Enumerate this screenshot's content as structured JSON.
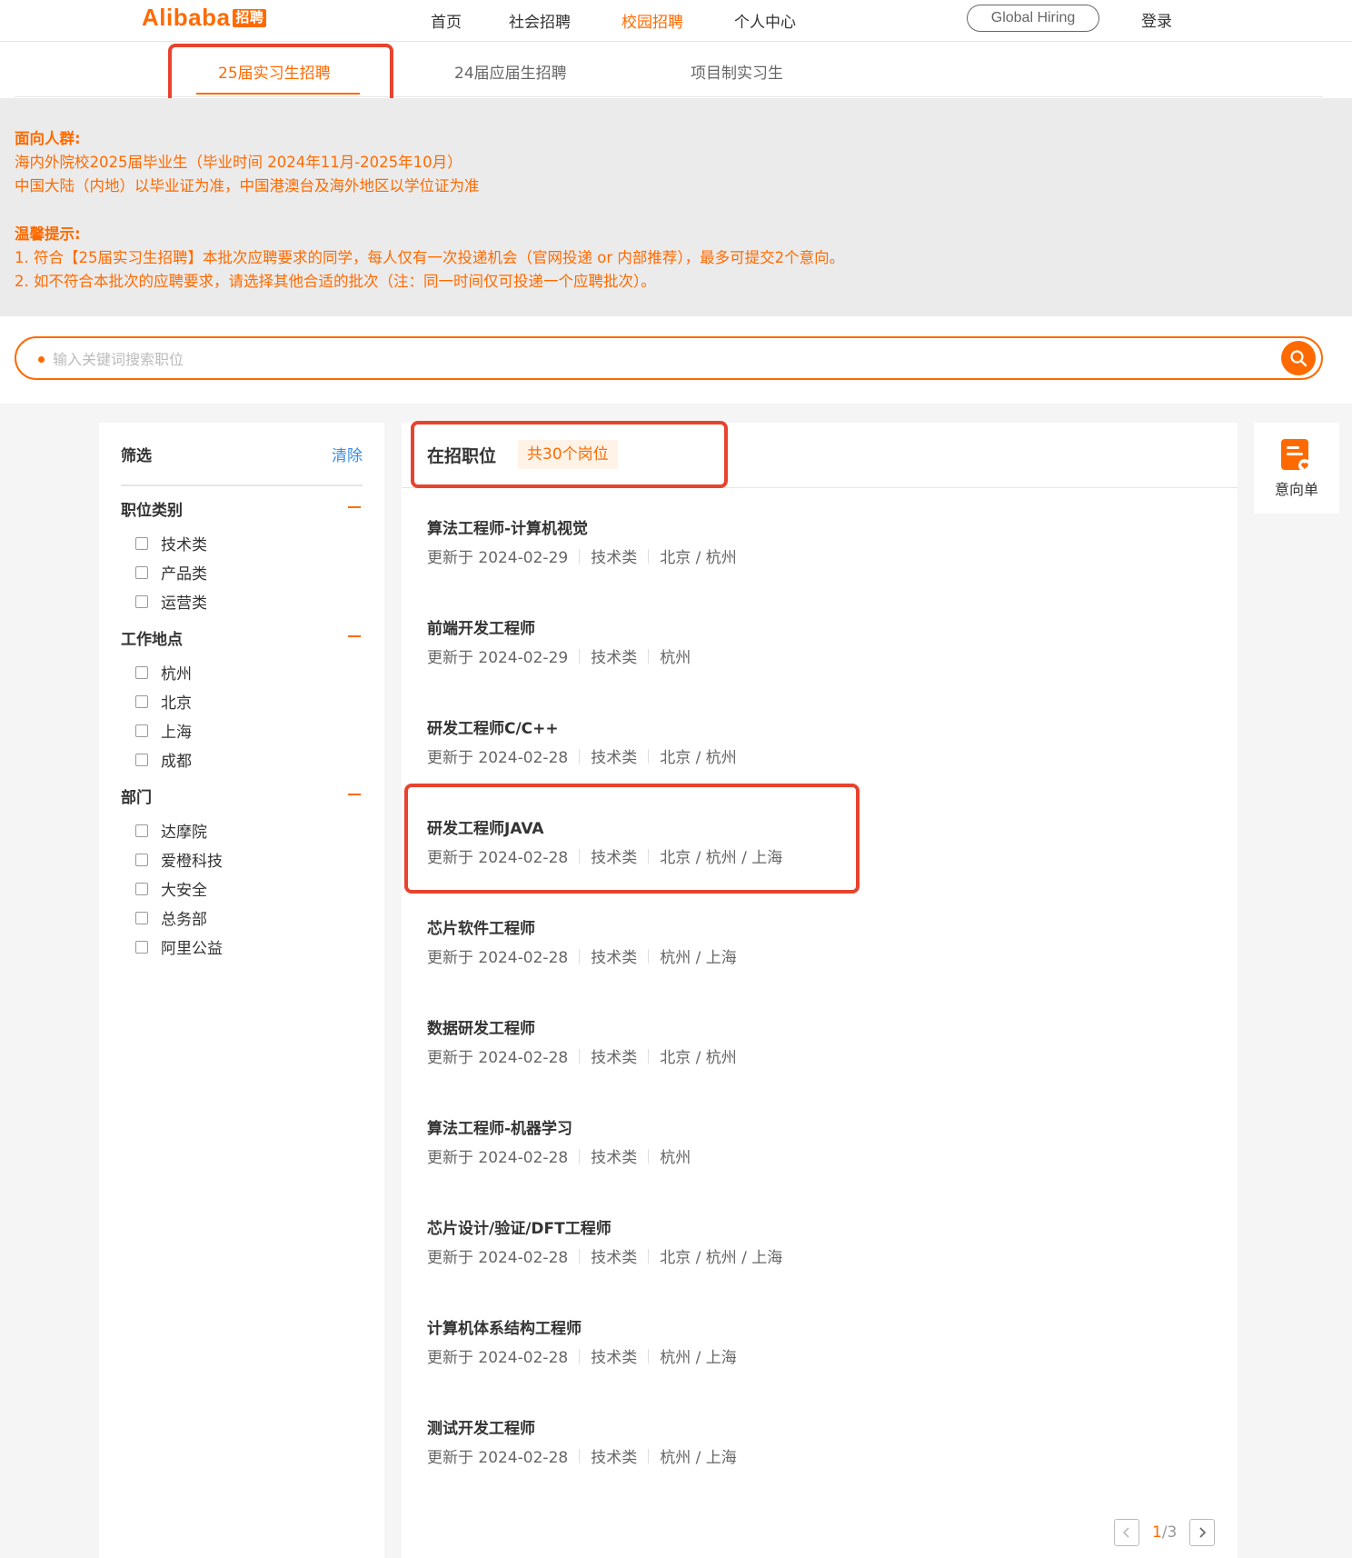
{
  "header": {
    "logo_text": "Alibaba",
    "logo_badge": "招聘",
    "nav": [
      "首页",
      "社会招聘",
      "校园招聘",
      "个人中心"
    ],
    "active_nav": "校园招聘",
    "global_hiring": "Global Hiring",
    "login": "登录"
  },
  "tabs": [
    "25届实习生招聘",
    "24届应届生招聘",
    "项目制实习生"
  ],
  "active_tab": "25届实习生招聘",
  "notice": {
    "audience_title": "面向人群:",
    "audience_lines": [
      "海内外院校2025届毕业生（毕业时间 2024年11月-2025年10月）",
      "中国大陆（内地）以毕业证为准，中国港澳台及海外地区以学位证为准"
    ],
    "tips_title": "温馨提示:",
    "tips_lines": [
      "1. 符合【25届实习生招聘】本批次应聘要求的同学，每人仅有一次投递机会（官网投递 or 内部推荐），最多可提交2个意向。",
      "2. 如不符合本批次的应聘要求，请选择其他合适的批次（注：同一时间仅可投递一个应聘批次）。"
    ]
  },
  "search": {
    "placeholder": "输入关键词搜索职位",
    "value": ""
  },
  "filter": {
    "title": "筛选",
    "clear": "清除",
    "groups": [
      {
        "title": "职位类别",
        "options": [
          "技术类",
          "产品类",
          "运营类"
        ]
      },
      {
        "title": "工作地点",
        "options": [
          "杭州",
          "北京",
          "上海",
          "成都"
        ]
      },
      {
        "title": "部门",
        "options": [
          "达摩院",
          "爱橙科技",
          "大安全",
          "总务部",
          "阿里公益"
        ]
      }
    ]
  },
  "jobs": {
    "title": "在招职位",
    "count": "共30个岗位",
    "items": [
      {
        "title": "算法工程师-计算机视觉",
        "updated": "更新于 2024-02-29",
        "category": "技术类",
        "location": "北京 / 杭州"
      },
      {
        "title": "前端开发工程师",
        "updated": "更新于 2024-02-29",
        "category": "技术类",
        "location": "杭州"
      },
      {
        "title": "研发工程师C/C++",
        "updated": "更新于 2024-02-28",
        "category": "技术类",
        "location": "北京 / 杭州"
      },
      {
        "title": "研发工程师JAVA",
        "updated": "更新于 2024-02-28",
        "category": "技术类",
        "location": "北京 / 杭州 / 上海"
      },
      {
        "title": "芯片软件工程师",
        "updated": "更新于 2024-02-28",
        "category": "技术类",
        "location": "杭州 / 上海"
      },
      {
        "title": "数据研发工程师",
        "updated": "更新于 2024-02-28",
        "category": "技术类",
        "location": "北京 / 杭州"
      },
      {
        "title": "算法工程师-机器学习",
        "updated": "更新于 2024-02-28",
        "category": "技术类",
        "location": "杭州"
      },
      {
        "title": "芯片设计/验证/DFT工程师",
        "updated": "更新于 2024-02-28",
        "category": "技术类",
        "location": "北京 / 杭州 / 上海"
      },
      {
        "title": "计算机体系结构工程师",
        "updated": "更新于 2024-02-28",
        "category": "技术类",
        "location": "杭州 / 上海"
      },
      {
        "title": "测试开发工程师",
        "updated": "更新于 2024-02-28",
        "category": "技术类",
        "location": "杭州 / 上海"
      }
    ]
  },
  "pagination": {
    "current": "1",
    "total": "/3"
  },
  "intent": {
    "label": "意向单"
  },
  "colors": {
    "accent": "#ff6a00",
    "highlight_box": "#e8432e",
    "link": "#3a8ee6"
  },
  "icons": {
    "search": "search-icon",
    "intent": "intent-list-icon",
    "prev": "chevron-left-icon",
    "next": "chevron-right-icon"
  }
}
